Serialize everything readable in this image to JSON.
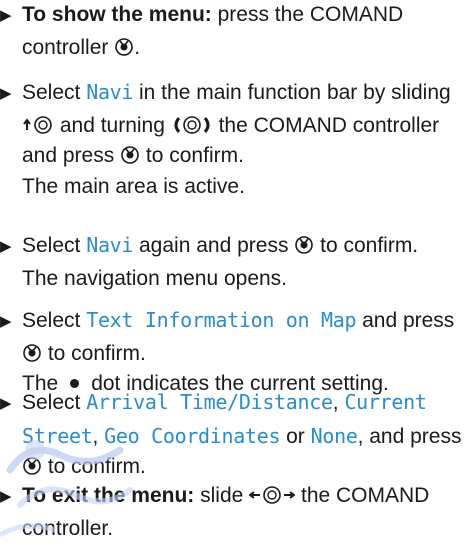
{
  "steps": [
    {
      "bold": "To show the menu:",
      "text": " press the COMAND controller ",
      "end": "."
    },
    {
      "a": "Select ",
      "ui": "Navi",
      "b": " in the main function bar by sliding ",
      "c": " and turning ",
      "d": " the COMAND controller and press ",
      "e": " to confirm.",
      "result": "The main area is active."
    },
    {
      "a": "Select ",
      "ui": "Navi",
      "b": " again and press ",
      "c": " to confirm.",
      "result": "The navigation menu opens."
    },
    {
      "a": "Select ",
      "ui": "Text Information on Map",
      "b": " and press ",
      "c": " to confirm.",
      "result_a": "The",
      "result_b": "dot indicates the current setting."
    },
    {
      "a": "Select ",
      "ui1": "Arrival Time/Distance",
      "s1": ", ",
      "ui2": "Current Street",
      "s2": ", ",
      "ui3": "Geo Coordinates",
      "s3": " or ",
      "ui4": "None",
      "b": ", and press ",
      "c": " to confirm."
    },
    {
      "bold": "To exit the menu:",
      "text": " slide ",
      "text2": " the COMAND controller."
    }
  ],
  "colors": {
    "accent": "#2a8dc8",
    "text": "#1a1a1a"
  },
  "icons": [
    "press-controller-icon",
    "slide-up-controller-icon",
    "turn-controller-icon",
    "slide-left-right-controller-icon",
    "bullet-arrow-icon"
  ]
}
